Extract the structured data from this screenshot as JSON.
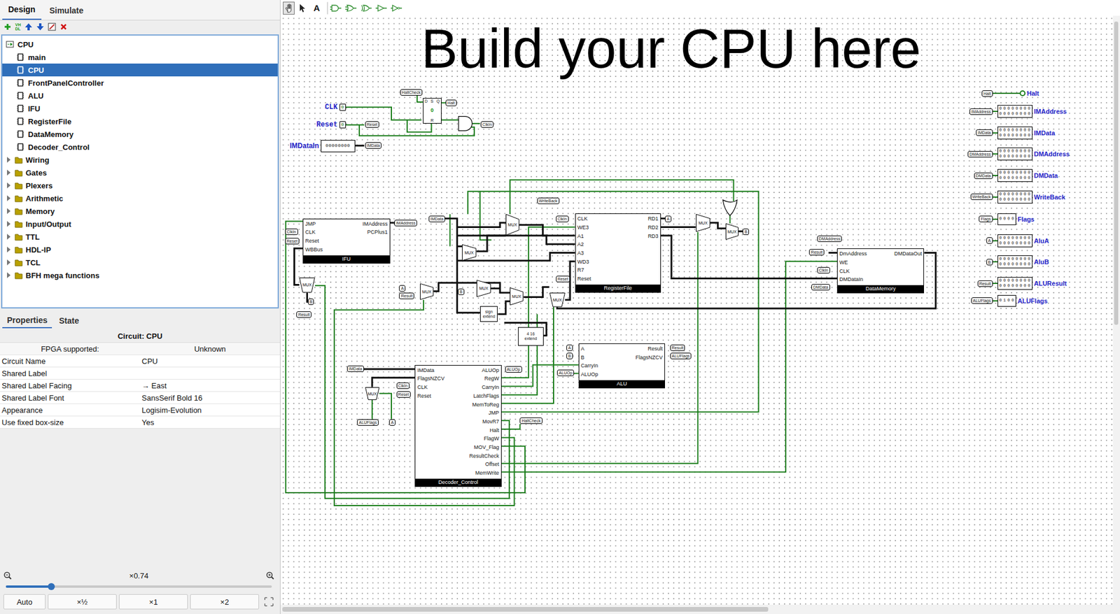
{
  "left_tabs": [
    {
      "label": "Design",
      "selected": true
    },
    {
      "label": "Simulate",
      "selected": false
    }
  ],
  "tree_toolbar": {
    "vhdl": [
      "VH",
      "DL"
    ]
  },
  "tree": {
    "root": {
      "label": "CPU",
      "expanded": true
    },
    "circuits": [
      {
        "label": "main",
        "selected": false
      },
      {
        "label": "CPU",
        "selected": true
      },
      {
        "label": "FrontPanelController",
        "selected": false
      },
      {
        "label": "ALU",
        "selected": false
      },
      {
        "label": "IFU",
        "selected": false
      },
      {
        "label": "RegisterFile",
        "selected": false
      },
      {
        "label": "DataMemory",
        "selected": false
      },
      {
        "label": "Decoder_Control",
        "selected": false
      }
    ],
    "libraries": [
      {
        "label": "Wiring",
        "expanded": false
      },
      {
        "label": "Gates",
        "expanded": false
      },
      {
        "label": "Plexers",
        "expanded": false
      },
      {
        "label": "Arithmetic",
        "expanded": false
      },
      {
        "label": "Memory",
        "expanded": false
      },
      {
        "label": "Input/Output",
        "expanded": false
      },
      {
        "label": "TTL",
        "expanded": false
      },
      {
        "label": "HDL-IP",
        "expanded": false
      },
      {
        "label": "TCL",
        "expanded": false
      },
      {
        "label": "BFH mega functions",
        "expanded": false
      }
    ]
  },
  "property_tabs": [
    {
      "label": "Properties",
      "selected": true
    },
    {
      "label": "State",
      "selected": false
    }
  ],
  "properties": {
    "title": "Circuit: CPU",
    "header": [
      "FPGA supported:",
      "Unknown"
    ],
    "rows": [
      {
        "name": "Circuit Name",
        "value": "CPU"
      },
      {
        "name": "Shared Label",
        "value": ""
      },
      {
        "name": "Shared Label Facing",
        "value": "→ East"
      },
      {
        "name": "Shared Label Font",
        "value": "SansSerif Bold 16"
      },
      {
        "name": "Appearance",
        "value": "Logisim-Evolution"
      },
      {
        "name": "Use fixed box-size",
        "value": "Yes"
      }
    ]
  },
  "zoom": {
    "reading": "×0.74",
    "level": 0.17,
    "buttons": [
      "Auto",
      "×½",
      "×1",
      "×2"
    ]
  },
  "canvas_tools": [
    {
      "kind": "hand",
      "label": "",
      "selected": true
    },
    {
      "kind": "arrow",
      "label": "",
      "selected": false
    },
    {
      "kind": "text",
      "label": "A",
      "selected": false
    },
    {
      "kind": "and",
      "label": "",
      "selected": false
    },
    {
      "kind": "or",
      "label": "",
      "selected": false
    },
    {
      "kind": "xor",
      "label": "",
      "selected": false
    },
    {
      "kind": "buffer",
      "label": "",
      "selected": false
    },
    {
      "kind": "not",
      "label": "",
      "selected": false
    }
  ],
  "scrollbars": {
    "vertical_level": 0.52,
    "horizontal_level": 0.58
  },
  "canvas": {
    "title": "Build your CPU here",
    "inputs": [
      {
        "label": "CLK",
        "value": "0",
        "kind": "bit"
      },
      {
        "label": "Reset",
        "value": "0",
        "kind": "bit"
      },
      {
        "label": "IMDataIn",
        "value": "00000000",
        "kind": "bus"
      }
    ],
    "flipflop": {
      "pins": [
        "D",
        "S",
        "Q",
        "R"
      ],
      "value": "0"
    },
    "outputs": [
      {
        "tunnel": "Halt",
        "label": "Halt",
        "kind": "led",
        "on": false,
        "value": ""
      },
      {
        "tunnel": "IMAddress",
        "label": "IMAddress",
        "kind": "probe",
        "on": false,
        "value": "0000000000000000"
      },
      {
        "tunnel": "IMData",
        "label": "IMData",
        "kind": "probe",
        "on": false,
        "value": "0000000000000000"
      },
      {
        "tunnel": "DMAddress",
        "label": "DMAddress",
        "kind": "probe",
        "on": false,
        "value": "0000000000000000"
      },
      {
        "tunnel": "DMData",
        "label": "DMData",
        "kind": "probe",
        "on": false,
        "value": "0000000000000000"
      },
      {
        "tunnel": "WriteBack",
        "label": "WriteBack",
        "kind": "probe",
        "on": false,
        "value": "0000000000000000"
      },
      {
        "tunnel": "Flags",
        "label": "Flags",
        "kind": "probe",
        "on": false,
        "value": "0000"
      },
      {
        "tunnel": "A",
        "label": "AluA",
        "kind": "probe",
        "on": false,
        "value": "0000000000000000"
      },
      {
        "tunnel": "B",
        "label": "AluB",
        "kind": "probe",
        "on": false,
        "value": "0000000000000000"
      },
      {
        "tunnel": "Result",
        "label": "ALUResult",
        "kind": "probe",
        "on": false,
        "value": "0000000000000000"
      },
      {
        "tunnel": "ALUFlags",
        "label": "ALUFlags",
        "kind": "probe",
        "on": false,
        "value": "0100"
      }
    ],
    "components": [
      {
        "name": "IFU",
        "inputs": [
          "JMP",
          "CLK",
          "Reset",
          "WBBus"
        ],
        "outputs": [
          "IMAddress",
          "PCPlus1"
        ]
      },
      {
        "name": "RegisterFile",
        "inputs": [
          "CLK",
          "WE3",
          "A1",
          "A2",
          "A3",
          "WD3",
          "R7",
          "Reset"
        ],
        "outputs": [
          "RD1",
          "RD2",
          "RD3"
        ]
      },
      {
        "name": "DataMemory",
        "inputs": [
          "DmAddress",
          "WE",
          "CLK",
          "DMDataIn"
        ],
        "outputs": [
          "DMDataOut"
        ]
      },
      {
        "name": "ALU",
        "inputs": [
          "A",
          "B",
          "CarryIn",
          "ALUOp"
        ],
        "outputs": [
          "Result",
          "FlagsNZCV"
        ]
      },
      {
        "name": "Decoder_Control",
        "inputs": [
          "IMData",
          "FlagsNZCV",
          "CLK",
          "Reset"
        ],
        "outputs": [
          "ALUOp",
          "RegW",
          "CarryIn",
          "LatchFlags",
          "MemToReg",
          "JMP",
          "MovR7",
          "Halt",
          "FlagW",
          "MOV_Flag",
          "ResultCheck",
          "Offset",
          "MemWrite"
        ]
      }
    ],
    "tunnels": [
      {
        "label": "HaltCheck"
      },
      {
        "label": "Halt"
      },
      {
        "label": "Reset"
      },
      {
        "label": "ClkIn"
      },
      {
        "label": "IMData"
      },
      {
        "label": "ClkIn"
      },
      {
        "label": "Reset"
      },
      {
        "label": "IMAddress"
      },
      {
        "label": "IMData"
      },
      {
        "label": "WriteBack"
      },
      {
        "label": "ClkIn"
      },
      {
        "label": "A"
      },
      {
        "label": "B"
      },
      {
        "label": "Reset"
      },
      {
        "label": "Result"
      },
      {
        "label": "B"
      },
      {
        "label": "A"
      },
      {
        "label": "Result"
      },
      {
        "label": "B"
      },
      {
        "label": "DMAddress"
      },
      {
        "label": "Result"
      },
      {
        "label": "ClkIn"
      },
      {
        "label": "DMData"
      },
      {
        "label": "A"
      },
      {
        "label": "B"
      },
      {
        "label": "Result"
      },
      {
        "label": "ALUFlags"
      },
      {
        "label": "ALUOp"
      },
      {
        "label": "IMData"
      },
      {
        "label": "ClkIn"
      },
      {
        "label": "Reset"
      },
      {
        "label": "ALUOp"
      },
      {
        "label": "HaltCheck"
      },
      {
        "label": "ALUFlags"
      },
      {
        "label": "A"
      }
    ],
    "muxes": [
      {
        "label": "MUX"
      },
      {
        "label": "MUX"
      },
      {
        "label": "MUX"
      },
      {
        "label": "MUX"
      },
      {
        "label": "MUX"
      },
      {
        "label": "MUX"
      },
      {
        "label": "MUX"
      },
      {
        "label": "MUX"
      },
      {
        "label": "MUX"
      },
      {
        "label": "MUX"
      }
    ],
    "extenders": [
      {
        "lines": [
          "sign",
          "extend"
        ]
      },
      {
        "lines": [
          "4 16",
          "extend"
        ]
      }
    ]
  }
}
